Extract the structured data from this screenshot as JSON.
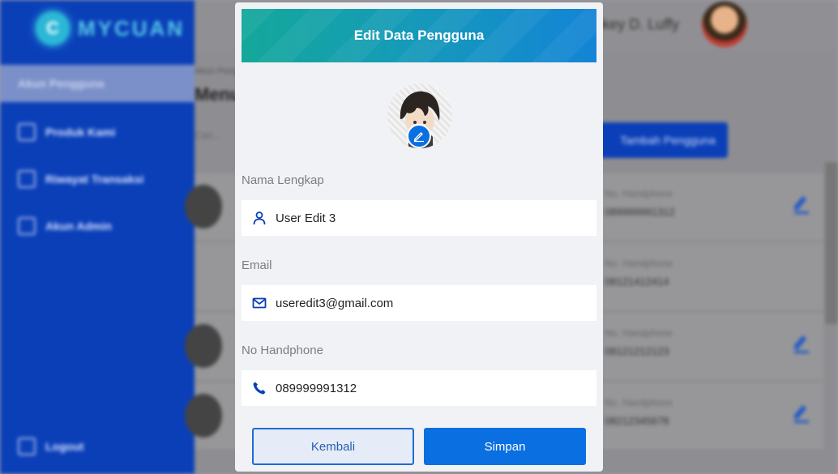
{
  "background": {
    "brand": "MYCUAN",
    "brand_initial": "C",
    "sidebar_items": [
      {
        "label": "Akun Pengguna",
        "icon": "users-icon"
      },
      {
        "label": "Produk Kami",
        "icon": "calendar-icon"
      },
      {
        "label": "Riwayat Transaksi",
        "icon": "receipt-icon"
      },
      {
        "label": "Akun Admin",
        "icon": "admin-icon"
      }
    ],
    "logout_label": "Logout",
    "user_name": "Monkey D. Luffy",
    "breadcrumb": "Akun Pengguna",
    "page_title": "Menu Pengguna",
    "search_placeholder": "Cari...",
    "add_button": "Tambah Pengguna",
    "rows": [
      {
        "label": "No. Handphone",
        "value": "089999991312"
      },
      {
        "label": "No. Handphone",
        "value": "08121412414"
      },
      {
        "label": "No. Handphone",
        "value": "08121212123"
      },
      {
        "label": "No. Handphone",
        "value": "08212345678"
      }
    ]
  },
  "modal": {
    "title": "Edit Data Pengguna",
    "fields": {
      "name": {
        "label": "Nama Lengkap",
        "value": "User Edit 3",
        "icon": "user-icon"
      },
      "email": {
        "label": "Email",
        "value": "useredit3@gmail.com",
        "icon": "mail-icon"
      },
      "phone": {
        "label": "No Handphone",
        "value": "089999991312",
        "icon": "phone-icon"
      }
    },
    "back_button": "Kembali",
    "save_button": "Simpan"
  },
  "colors": {
    "primary": "#0a6fe0",
    "sidebar": "#0a3fb8",
    "header_gradient_start": "#14a89a",
    "header_gradient_end": "#1484d6"
  }
}
